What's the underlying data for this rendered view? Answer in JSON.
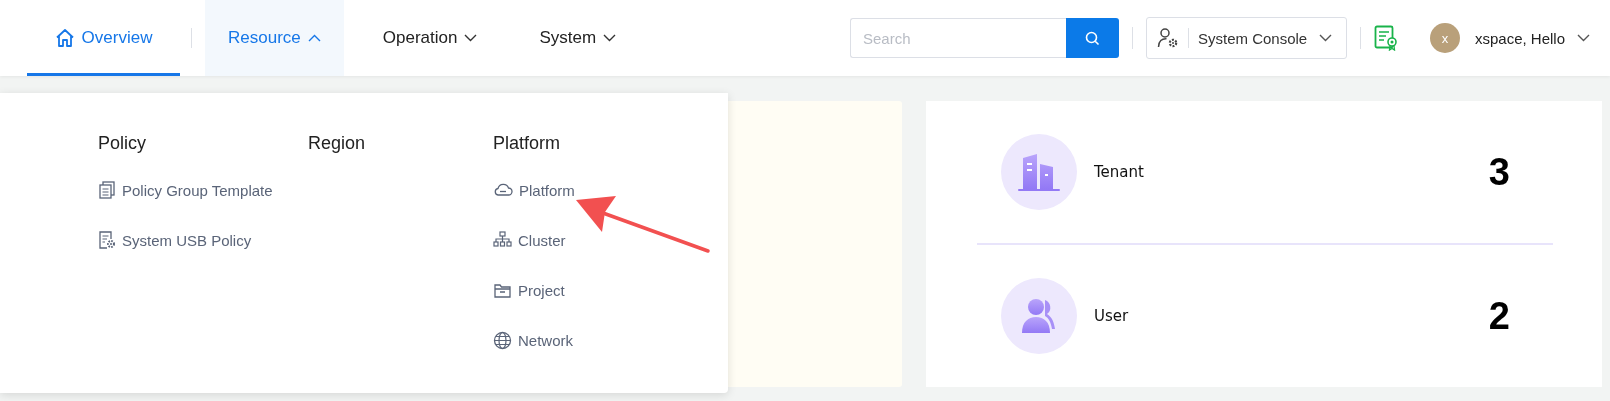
{
  "nav": {
    "tabs": [
      {
        "label": "Overview",
        "kind": "link",
        "selected": true
      },
      {
        "label": "Resource",
        "kind": "menu",
        "selected": false,
        "expanded": true
      },
      {
        "label": "Operation",
        "kind": "menu",
        "selected": false,
        "expanded": false
      },
      {
        "label": "System",
        "kind": "menu",
        "selected": false,
        "expanded": false
      }
    ]
  },
  "search": {
    "placeholder": "Search"
  },
  "console": {
    "label": "System Console"
  },
  "user": {
    "avatar": "x",
    "greeting": "xspace, Hello"
  },
  "resource_menu": {
    "columns": [
      {
        "title": "Policy",
        "items": [
          {
            "label": "Policy Group Template"
          },
          {
            "label": "System USB Policy"
          }
        ]
      },
      {
        "title": "Region"
      },
      {
        "title": "Platform",
        "items": [
          {
            "label": "Platform"
          },
          {
            "label": "Cluster"
          },
          {
            "label": "Project"
          },
          {
            "label": "Network"
          }
        ]
      }
    ]
  },
  "stats": [
    {
      "label": "Tenant",
      "value": "3"
    },
    {
      "label": "User",
      "value": "2"
    }
  ]
}
